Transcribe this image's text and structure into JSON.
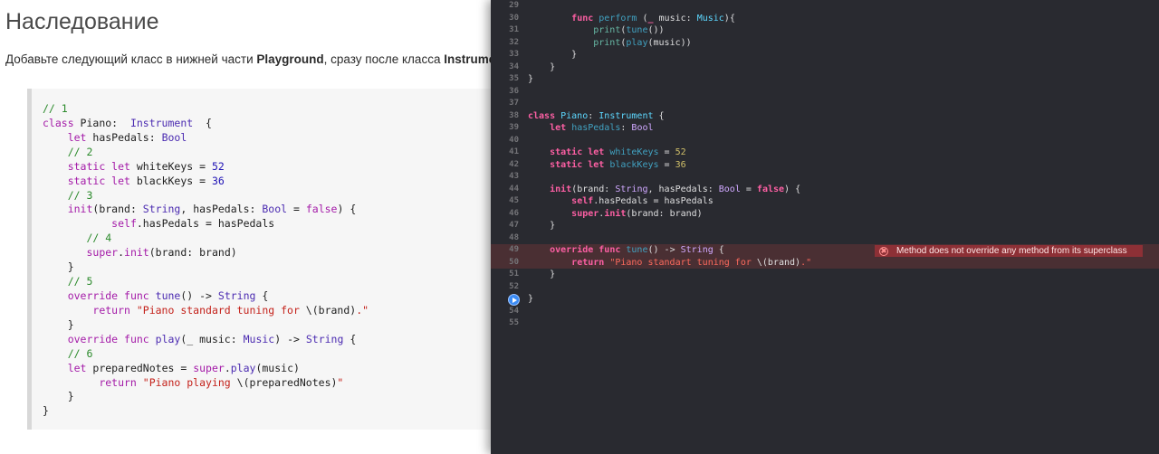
{
  "article": {
    "title": "Наследование",
    "intro_before": "Добавьте следующий класс в нижней части ",
    "intro_bold1": "Playground",
    "intro_mid": ", сразу после класса ",
    "intro_bold2": "Instrument",
    "snippet": [
      [
        [
          "t-com",
          "// 1"
        ]
      ],
      [
        [
          "t-kw",
          "class "
        ],
        [
          "t-plain",
          "Piano:  "
        ],
        [
          "t-type",
          "Instrument"
        ],
        [
          "t-plain",
          "  {"
        ]
      ],
      [
        [
          "t-plain",
          "    "
        ],
        [
          "t-kw",
          "let "
        ],
        [
          "t-plain",
          "hasPedals: "
        ],
        [
          "t-type",
          "Bool"
        ]
      ],
      [
        [
          "t-plain",
          "    "
        ],
        [
          "t-com",
          "// 2"
        ]
      ],
      [
        [
          "t-plain",
          "    "
        ],
        [
          "t-kw",
          "static let "
        ],
        [
          "t-plain",
          "whiteKeys = "
        ],
        [
          "t-num",
          "52"
        ]
      ],
      [
        [
          "t-plain",
          "    "
        ],
        [
          "t-kw",
          "static let "
        ],
        [
          "t-plain",
          "blackKeys = "
        ],
        [
          "t-num",
          "36"
        ]
      ],
      [
        [
          "t-plain",
          "    "
        ],
        [
          "t-com",
          "// 3"
        ]
      ],
      [
        [
          "t-plain",
          "    "
        ],
        [
          "t-kw",
          "init"
        ],
        [
          "t-plain",
          "(brand: "
        ],
        [
          "t-type",
          "String"
        ],
        [
          "t-plain",
          ", hasPedals: "
        ],
        [
          "t-type",
          "Bool"
        ],
        [
          "t-plain",
          " = "
        ],
        [
          "t-kw",
          "false"
        ],
        [
          "t-plain",
          ") {"
        ]
      ],
      [
        [
          "t-plain",
          "           "
        ],
        [
          "t-kw",
          "self"
        ],
        [
          "t-plain",
          ".hasPedals = hasPedals"
        ]
      ],
      [
        [
          "t-plain",
          "       "
        ],
        [
          "t-com",
          "// 4"
        ]
      ],
      [
        [
          "t-plain",
          "       "
        ],
        [
          "t-kw",
          "super"
        ],
        [
          "t-plain",
          "."
        ],
        [
          "t-kw",
          "init"
        ],
        [
          "t-plain",
          "(brand: brand)"
        ]
      ],
      [
        [
          "t-plain",
          "    }"
        ]
      ],
      [
        [
          "t-plain",
          "    "
        ],
        [
          "t-com",
          "// 5"
        ]
      ],
      [
        [
          "t-plain",
          "    "
        ],
        [
          "t-kw",
          "override func "
        ],
        [
          "t-type",
          "tune"
        ],
        [
          "t-plain",
          "() -> "
        ],
        [
          "t-type",
          "String"
        ],
        [
          "t-plain",
          " {"
        ]
      ],
      [
        [
          "t-plain",
          "        "
        ],
        [
          "t-kw",
          "return "
        ],
        [
          "t-str",
          "\"Piano standard tuning for "
        ],
        [
          "t-plain",
          "\\(brand)"
        ],
        [
          "t-str",
          ".\""
        ]
      ],
      [
        [
          "t-plain",
          "    }"
        ]
      ],
      [
        [
          "t-plain",
          "    "
        ],
        [
          "t-kw",
          "override func "
        ],
        [
          "t-type",
          "play"
        ],
        [
          "t-plain",
          "(_ music: "
        ],
        [
          "t-type",
          "Music"
        ],
        [
          "t-plain",
          ") -> "
        ],
        [
          "t-type",
          "String"
        ],
        [
          "t-plain",
          " {"
        ]
      ],
      [
        [
          "t-plain",
          "    "
        ],
        [
          "t-com",
          "// 6"
        ]
      ],
      [
        [
          "t-plain",
          "    "
        ],
        [
          "t-kw",
          "let "
        ],
        [
          "t-plain",
          "preparedNotes = "
        ],
        [
          "t-kw",
          "super"
        ],
        [
          "t-plain",
          "."
        ],
        [
          "t-type",
          "play"
        ],
        [
          "t-plain",
          "(music)"
        ]
      ],
      [
        [
          "t-plain",
          "         "
        ],
        [
          "t-kw",
          "return "
        ],
        [
          "t-str",
          "\"Piano playing "
        ],
        [
          "t-plain",
          "\\(preparedNotes)"
        ],
        [
          "t-str",
          "\""
        ]
      ],
      [
        [
          "t-plain",
          "    }"
        ]
      ],
      [
        [
          "t-plain",
          "}"
        ]
      ]
    ]
  },
  "editor": {
    "lines": [
      {
        "num": "29",
        "code": []
      },
      {
        "num": "30",
        "code": [
          [
            "x-plain",
            "        "
          ],
          [
            "x-kw",
            "func "
          ],
          [
            "x-fnn",
            "perform"
          ],
          [
            "x-plain",
            " ("
          ],
          [
            "x-kw",
            "_"
          ],
          [
            "x-plain",
            " music: "
          ],
          [
            "x-typeu",
            "Music"
          ],
          [
            "x-plain",
            "){"
          ]
        ]
      },
      {
        "num": "31",
        "code": [
          [
            "x-plain",
            "            "
          ],
          [
            "x-fn",
            "print"
          ],
          [
            "x-plain",
            "("
          ],
          [
            "x-fnn",
            "tune"
          ],
          [
            "x-plain",
            "())"
          ]
        ]
      },
      {
        "num": "32",
        "code": [
          [
            "x-plain",
            "            "
          ],
          [
            "x-fn",
            "print"
          ],
          [
            "x-plain",
            "("
          ],
          [
            "x-fnn",
            "play"
          ],
          [
            "x-plain",
            "(music))"
          ]
        ]
      },
      {
        "num": "33",
        "code": [
          [
            "x-plain",
            "        }"
          ]
        ]
      },
      {
        "num": "34",
        "code": [
          [
            "x-plain",
            "    }"
          ]
        ]
      },
      {
        "num": "35",
        "code": [
          [
            "x-plain",
            "}"
          ]
        ]
      },
      {
        "num": "36",
        "code": []
      },
      {
        "num": "37",
        "code": []
      },
      {
        "num": "38",
        "code": [
          [
            "x-kw",
            "class "
          ],
          [
            "x-typeu",
            "Piano"
          ],
          [
            "x-plain",
            ": "
          ],
          [
            "x-typeu",
            "Instrument"
          ],
          [
            "x-plain",
            " {"
          ]
        ]
      },
      {
        "num": "39",
        "code": [
          [
            "x-plain",
            "    "
          ],
          [
            "x-kw",
            "let "
          ],
          [
            "x-prop",
            "hasPedals"
          ],
          [
            "x-plain",
            ": "
          ],
          [
            "x-type",
            "Bool"
          ]
        ]
      },
      {
        "num": "40",
        "code": []
      },
      {
        "num": "41",
        "code": [
          [
            "x-plain",
            "    "
          ],
          [
            "x-kw",
            "static let "
          ],
          [
            "x-prop",
            "whiteKeys"
          ],
          [
            "x-plain",
            " = "
          ],
          [
            "x-num",
            "52"
          ]
        ]
      },
      {
        "num": "42",
        "code": [
          [
            "x-plain",
            "    "
          ],
          [
            "x-kw",
            "static let "
          ],
          [
            "x-prop",
            "blackKeys"
          ],
          [
            "x-plain",
            " = "
          ],
          [
            "x-num",
            "36"
          ]
        ]
      },
      {
        "num": "43",
        "code": []
      },
      {
        "num": "44",
        "code": [
          [
            "x-plain",
            "    "
          ],
          [
            "x-kw",
            "init"
          ],
          [
            "x-plain",
            "(brand: "
          ],
          [
            "x-type",
            "String"
          ],
          [
            "x-plain",
            ", hasPedals: "
          ],
          [
            "x-type",
            "Bool"
          ],
          [
            "x-plain",
            " = "
          ],
          [
            "x-kw",
            "false"
          ],
          [
            "x-plain",
            ") {"
          ]
        ]
      },
      {
        "num": "45",
        "code": [
          [
            "x-plain",
            "        "
          ],
          [
            "x-kw",
            "self"
          ],
          [
            "x-plain",
            ".hasPedals = hasPedals"
          ]
        ]
      },
      {
        "num": "46",
        "code": [
          [
            "x-plain",
            "        "
          ],
          [
            "x-kw",
            "super"
          ],
          [
            "x-plain",
            "."
          ],
          [
            "x-kw",
            "init"
          ],
          [
            "x-plain",
            "(brand: brand)"
          ]
        ]
      },
      {
        "num": "47",
        "code": [
          [
            "x-plain",
            "    }"
          ]
        ]
      },
      {
        "num": "48",
        "code": []
      },
      {
        "num": "49",
        "code": [
          [
            "x-plain",
            "    "
          ],
          [
            "x-kw",
            "override func "
          ],
          [
            "x-fnn",
            "tune"
          ],
          [
            "x-plain",
            "() -> "
          ],
          [
            "x-type",
            "String"
          ],
          [
            "x-plain",
            " {"
          ]
        ],
        "error": true
      },
      {
        "num": "50",
        "code": [
          [
            "x-plain",
            "        "
          ],
          [
            "x-kw",
            "return "
          ],
          [
            "x-str",
            "\"Piano standart tuning for "
          ],
          [
            "x-plain",
            "\\(brand)"
          ],
          [
            "x-str",
            ".\""
          ]
        ],
        "error": true
      },
      {
        "num": "51",
        "code": [
          [
            "x-plain",
            "    }"
          ]
        ]
      },
      {
        "num": "52",
        "code": []
      },
      {
        "num": "53",
        "code": [
          [
            "x-plain",
            "}"
          ]
        ],
        "current": true
      },
      {
        "num": "54",
        "code": []
      },
      {
        "num": "55",
        "code": []
      }
    ],
    "error_message": "Method does not override any method from its superclass"
  }
}
